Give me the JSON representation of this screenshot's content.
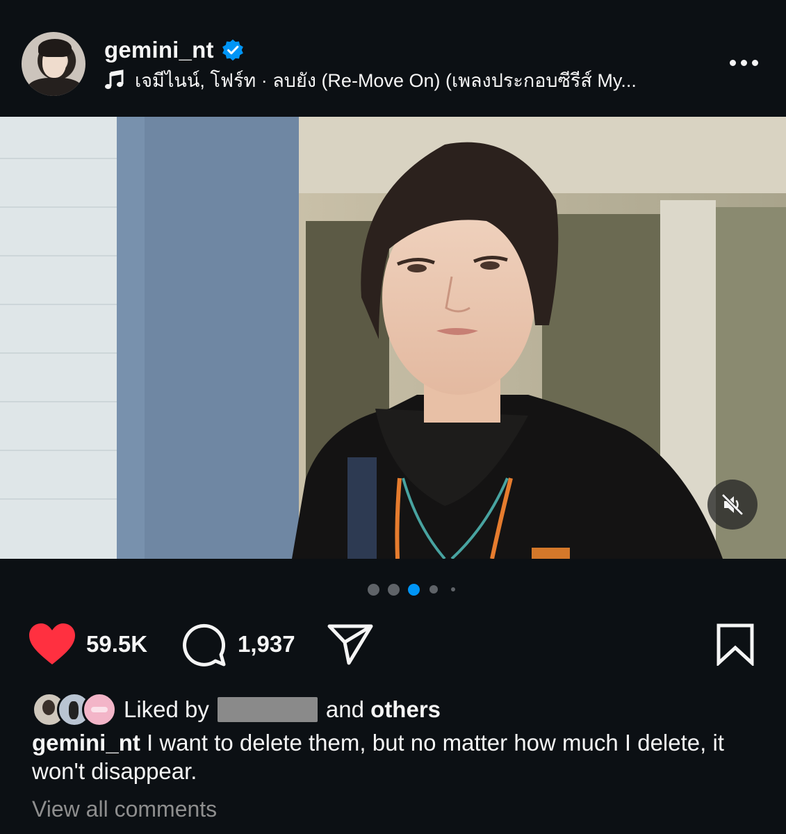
{
  "post": {
    "username": "gemini_nt",
    "verified": true,
    "music": "เจมีไนน์, โฟร์ท · ลบยัง (Re-Move On) (เพลงประกอบซีรีส์ My...",
    "more_icon": "more-horizontal-icon"
  },
  "media": {
    "type": "video",
    "muted": true,
    "carousel": {
      "total": 5,
      "active_index": 2
    }
  },
  "actions": {
    "likes": "59.5K",
    "comments": "1,937",
    "liked": true
  },
  "likes": {
    "prefix": "Liked by",
    "conjunction": "and",
    "others": "others"
  },
  "caption": {
    "username": "gemini_nt",
    "text": "I want to delete them, but no matter how much I delete, it won't disappear."
  },
  "view_all_comments": "View all comments",
  "colors": {
    "background": "#0c1014",
    "heart": "#ff3040",
    "verified": "#0095f6",
    "active_dot": "#0095f6"
  }
}
